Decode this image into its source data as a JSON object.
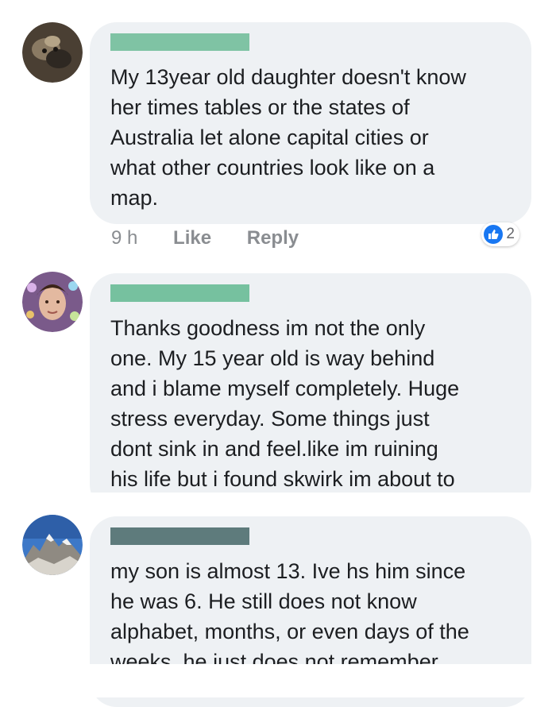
{
  "comments": [
    {
      "name_bar_color": "#7fc3a4",
      "text": "My 13year old daughter doesn't know\nher times tables or the states of\nAustralia let alone capital cities or\nwhat other countries look like on a\nmap.",
      "time": "9 h",
      "like_label": "Like",
      "reply_label": "Reply",
      "reaction_icon": "like-icon",
      "reaction_count": "2"
    },
    {
      "name_bar_color": "#76c19f",
      "text": "Thanks goodness im not the only\none. My 15 year old is way behind\nand i blame myself completely. Huge\nstress everyday. Some things just\ndont sink in and feel.like im ruining\nhis life but i found skwirk im about to"
    },
    {
      "name_bar_color": "#5e7b7c",
      "text": "my son is almost 13. Ive hs him since\nhe was 6. He still does not know\nalphabet, months, or even days of the\nweeks. he just does not remember"
    }
  ],
  "colors": {
    "bubble_bg": "#eef1f4",
    "text": "#1c1e21",
    "meta_text": "#8a8d91",
    "like_blue": "#1877f2"
  }
}
